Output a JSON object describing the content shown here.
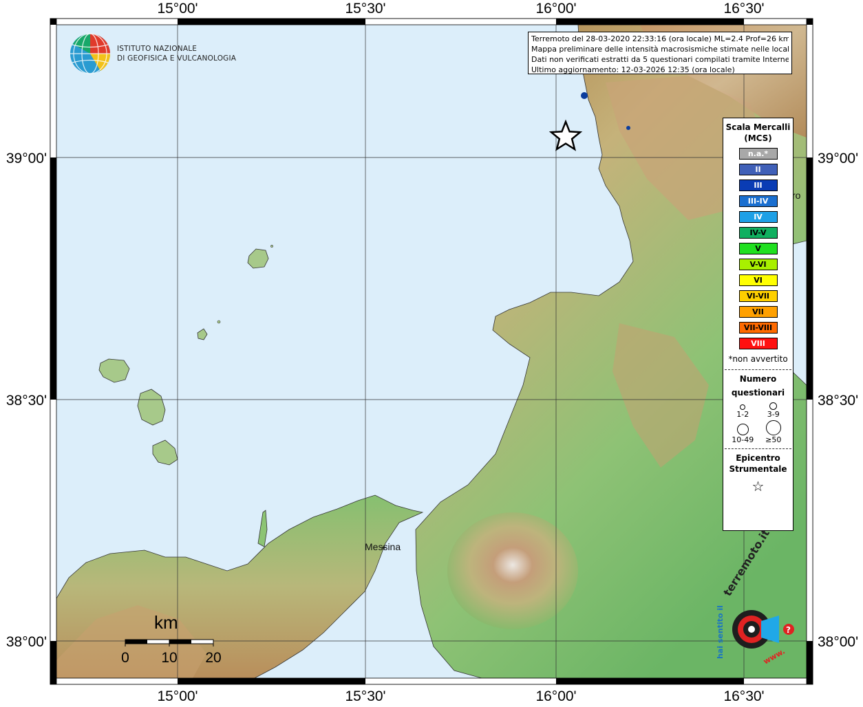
{
  "map": {
    "lon_ticks_top": [
      "15°00'",
      "15°30'",
      "16°00'",
      "16°30'"
    ],
    "lon_ticks_bottom": [
      "15°00'",
      "15°30'",
      "16°00'",
      "16°30'"
    ],
    "lat_ticks_left": [
      "39°00'",
      "38°30'",
      "38°00'"
    ],
    "lat_ticks_right": [
      "39°00'",
      "38°30'",
      "38°00'"
    ],
    "places": {
      "messina": "Messina",
      "partial_right": "ro"
    },
    "colors": {
      "sea": "#dceefa",
      "land_low": "#7dbf6a",
      "land_mid": "#c8c07c",
      "land_high": "#a87a4d",
      "peak": "#e8e3de",
      "felt_point": "#0b3d9e"
    }
  },
  "institute": {
    "line1": "ISTITUTO NAZIONALE",
    "line2": "DI GEOFISICA E VULCANOLOGIA"
  },
  "info": {
    "line1": "Terremoto del 28-03-2020 22:33:16 (ora locale) ML=2.4 Prof=26 km",
    "line2": "Mappa preliminare delle intensità macrosismiche stimate nelle località",
    "line3": "Dati non verificati estratti da 5 questionari compilati tramite Internet.",
    "line4": "Ultimo aggiornamento: 12-03-2026 12:35 (ora locale)"
  },
  "legend": {
    "title": "Scala Mercalli (MCS)",
    "intensities": [
      {
        "label": "n.a.*",
        "color": "#a8a8a8",
        "text_color": "#ffffff"
      },
      {
        "label": "II",
        "color": "#4060b8",
        "text_color": "#ffffff"
      },
      {
        "label": "III",
        "color": "#0a3cb4",
        "text_color": "#ffffff"
      },
      {
        "label": "III-IV",
        "color": "#1a6fd0",
        "text_color": "#ffffff"
      },
      {
        "label": "IV",
        "color": "#1ea0e6",
        "text_color": "#ffffff"
      },
      {
        "label": "IV-V",
        "color": "#10b060",
        "text_color": "#000000"
      },
      {
        "label": "V",
        "color": "#20e020",
        "text_color": "#000000"
      },
      {
        "label": "V-VI",
        "color": "#a8f000",
        "text_color": "#000000"
      },
      {
        "label": "VI",
        "color": "#ffff00",
        "text_color": "#000000"
      },
      {
        "label": "VI-VII",
        "color": "#ffd000",
        "text_color": "#000000"
      },
      {
        "label": "VII",
        "color": "#ffa000",
        "text_color": "#000000"
      },
      {
        "label": "VII-VIII",
        "color": "#ff6a00",
        "text_color": "#000000"
      },
      {
        "label": "VIII",
        "color": "#ff1010",
        "text_color": "#ffffff"
      }
    ],
    "note": "*non avvertito",
    "count_title_1": "Numero",
    "count_title_2": "questionari",
    "counts": [
      "1-2",
      "3-9",
      "10-49",
      "≥50"
    ],
    "epicenter_title_1": "Epicentro",
    "epicenter_title_2": "Strumentale",
    "epicenter_symbol": "☆"
  },
  "scale_bar": {
    "title": "km",
    "ticks": [
      "0",
      "10",
      "20"
    ]
  },
  "badge": {
    "text_top": "terremoto.it",
    "text_left": "hai sentito il",
    "text_bottom": "www."
  }
}
